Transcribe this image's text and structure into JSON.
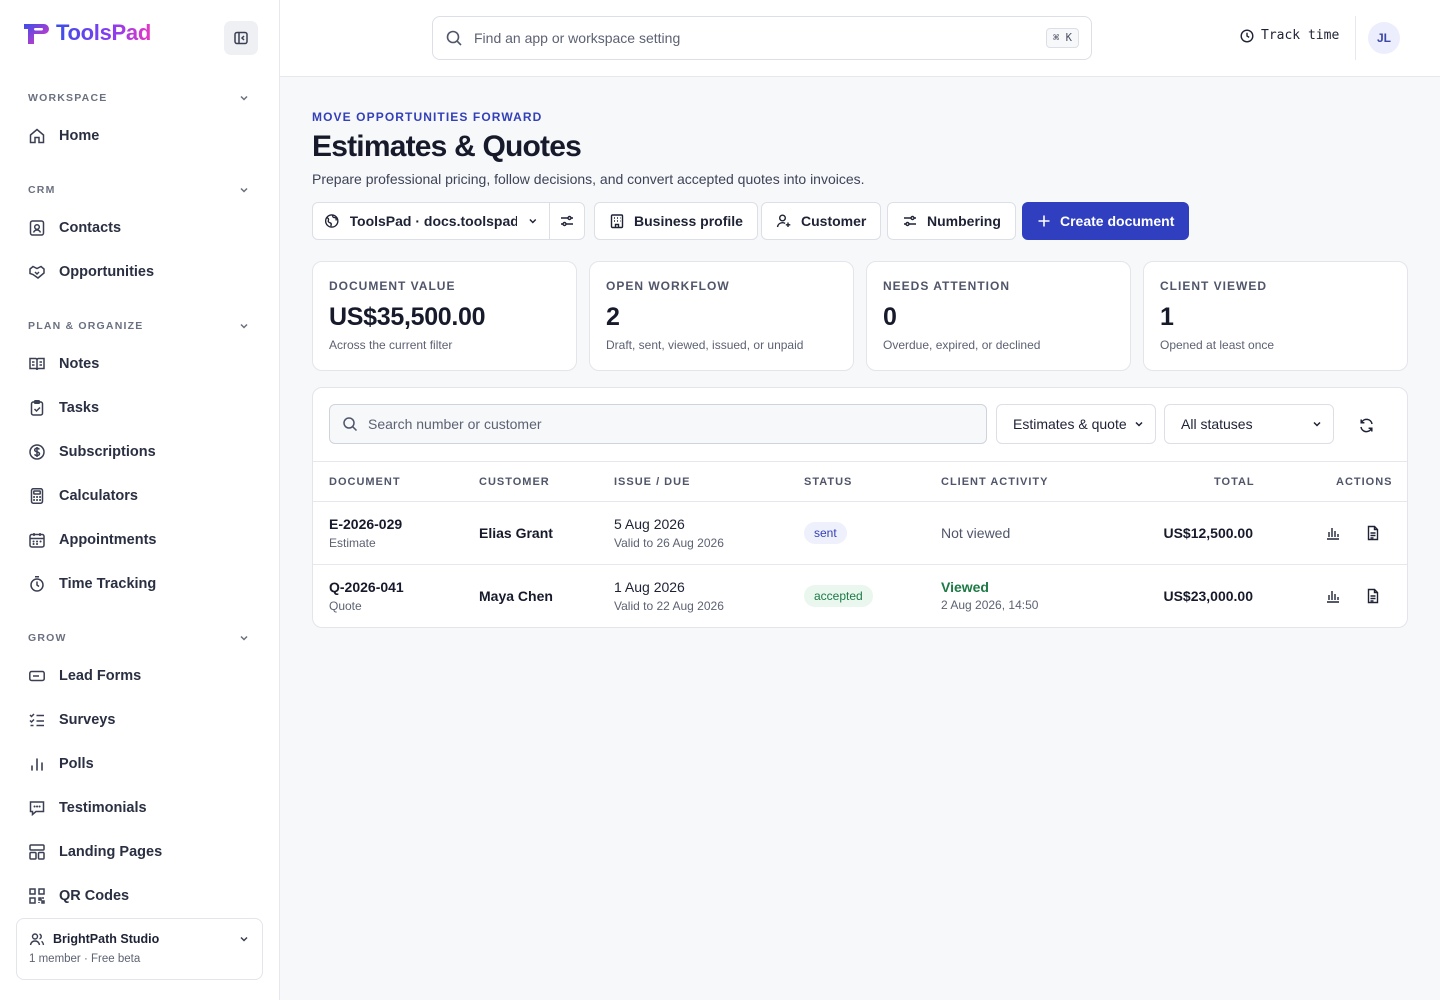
{
  "brand": {
    "name": "ToolsPad",
    "accent": "#2f3fbf"
  },
  "sidebar": {
    "sections": [
      {
        "label": "WORKSPACE",
        "items": [
          {
            "label": "Home",
            "icon": "home-icon"
          }
        ]
      },
      {
        "label": "CRM",
        "items": [
          {
            "label": "Contacts",
            "icon": "contact-card-icon"
          },
          {
            "label": "Opportunities",
            "icon": "handshake-icon"
          }
        ]
      },
      {
        "label": "PLAN & ORGANIZE",
        "items": [
          {
            "label": "Notes",
            "icon": "notebook-icon"
          },
          {
            "label": "Tasks",
            "icon": "clipboard-check-icon"
          },
          {
            "label": "Subscriptions",
            "icon": "dollar-circle-icon"
          },
          {
            "label": "Calculators",
            "icon": "calculator-icon"
          },
          {
            "label": "Appointments",
            "icon": "calendar-icon"
          },
          {
            "label": "Time Tracking",
            "icon": "stopwatch-icon"
          }
        ]
      },
      {
        "label": "GROW",
        "items": [
          {
            "label": "Lead Forms",
            "icon": "form-icon"
          },
          {
            "label": "Surveys",
            "icon": "checklist-icon"
          },
          {
            "label": "Polls",
            "icon": "bar-chart-icon"
          },
          {
            "label": "Testimonials",
            "icon": "speech-bubble-icon"
          },
          {
            "label": "Landing Pages",
            "icon": "layout-icon"
          },
          {
            "label": "QR Codes",
            "icon": "qr-code-icon"
          }
        ]
      }
    ],
    "team": {
      "name": "BrightPath Studio",
      "sub": "1 member · Free beta"
    }
  },
  "topbar": {
    "search_placeholder": "Find an app or workspace setting",
    "shortcut": "⌘ K",
    "track_time": "Track time",
    "avatar_initials": "JL"
  },
  "page": {
    "eyebrow": "MOVE OPPORTUNITIES FORWARD",
    "title": "Estimates & Quotes",
    "description": "Prepare professional pricing, follow decisions, and convert accepted quotes into invoices."
  },
  "toolbar": {
    "workspace": "ToolsPad · docs.toolspad.",
    "business_profile": "Business profile",
    "customer": "Customer",
    "numbering": "Numbering",
    "create": "Create document"
  },
  "stats": [
    {
      "label": "DOCUMENT VALUE",
      "value": "US$35,500.00",
      "note": "Across the current filter"
    },
    {
      "label": "OPEN WORKFLOW",
      "value": "2",
      "note": "Draft, sent, viewed, issued, or unpaid"
    },
    {
      "label": "NEEDS ATTENTION",
      "value": "0",
      "note": "Overdue, expired, or declined"
    },
    {
      "label": "CLIENT VIEWED",
      "value": "1",
      "note": "Opened at least once"
    }
  ],
  "filters": {
    "search_placeholder": "Search number or customer",
    "type": "Estimates & quote",
    "status": "All statuses"
  },
  "table": {
    "headers": [
      "DOCUMENT",
      "CUSTOMER",
      "ISSUE / DUE",
      "STATUS",
      "CLIENT ACTIVITY",
      "TOTAL",
      "ACTIONS"
    ],
    "rows": [
      {
        "number": "E-2026-029",
        "type": "Estimate",
        "customer": "Elias Grant",
        "issue": "5 Aug 2026",
        "valid": "Valid to 26 Aug 2026",
        "status": "sent",
        "activity": "Not viewed",
        "activity_time": "",
        "total": "US$12,500.00"
      },
      {
        "number": "Q-2026-041",
        "type": "Quote",
        "customer": "Maya Chen",
        "issue": "1 Aug 2026",
        "valid": "Valid to 22 Aug 2026",
        "status": "accepted",
        "activity": "Viewed",
        "activity_time": "2 Aug 2026, 14:50",
        "total": "US$23,000.00"
      }
    ]
  }
}
